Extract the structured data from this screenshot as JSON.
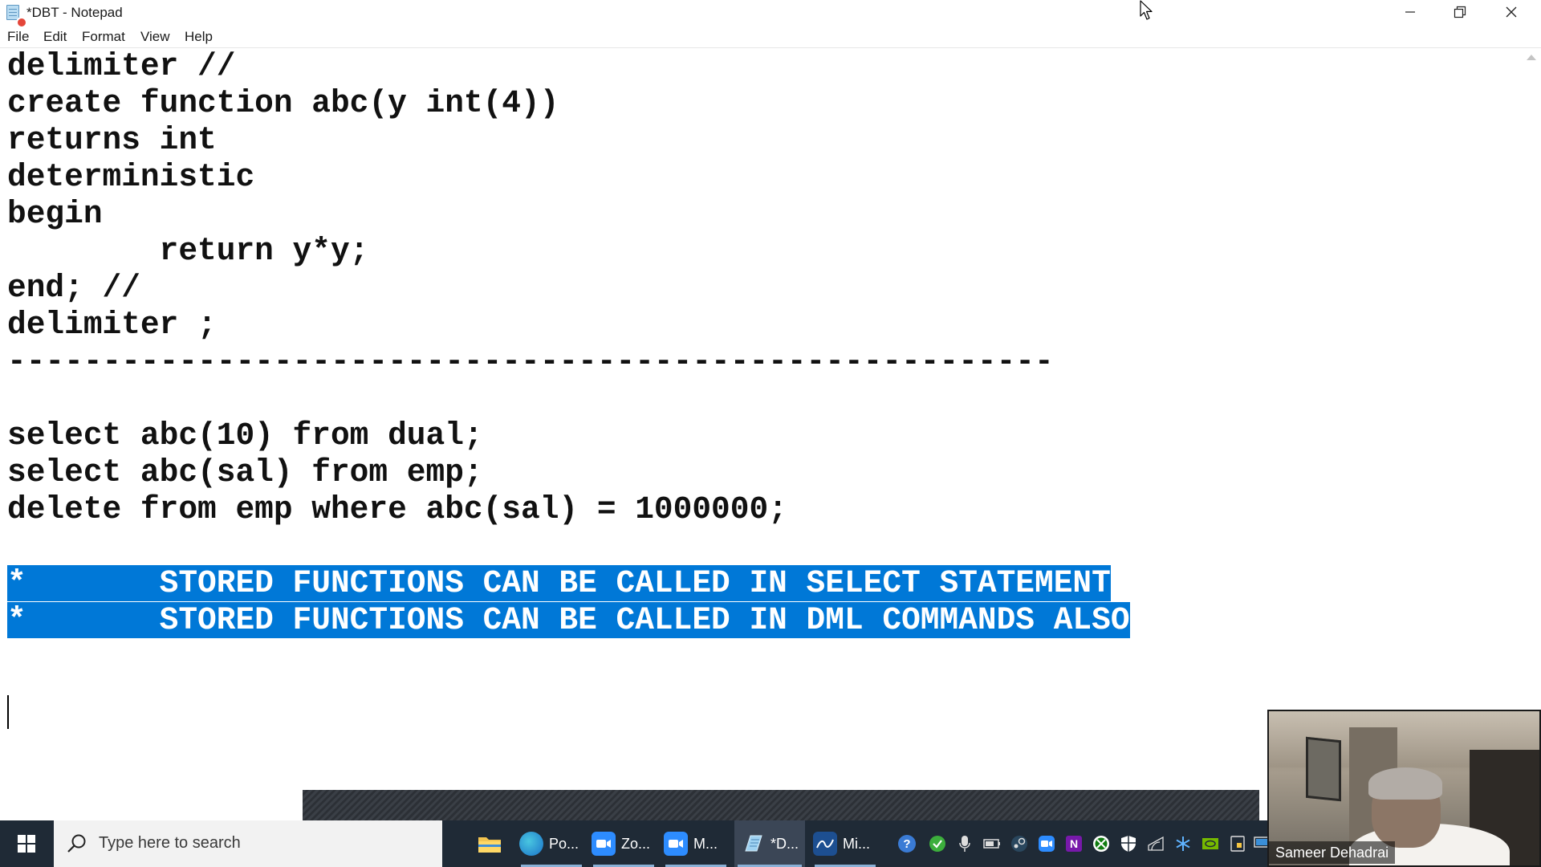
{
  "window": {
    "title": "*DBT - Notepad"
  },
  "menu": {
    "file": "File",
    "edit": "Edit",
    "format": "Format",
    "view": "View",
    "help": "Help"
  },
  "editor": {
    "lines": [
      "delimiter //",
      "create function abc(y int(4))",
      "returns int",
      "deterministic",
      "begin",
      "        return y*y;",
      "end; //",
      "delimiter ;",
      "-------------------------------------------------------",
      "",
      "select abc(10) from dual;",
      "select abc(sal) from emp;",
      "delete from emp where abc(sal) = 1000000;",
      ""
    ],
    "selected_lines": [
      "*       STORED FUNCTIONS CAN BE CALLED IN SELECT STATEMENT",
      "*       STORED FUNCTIONS CAN BE CALLED IN DML COMMANDS ALSO"
    ],
    "selection_color": "#0078d7"
  },
  "taskbar": {
    "search_placeholder": "Type here to search",
    "apps": [
      {
        "icon": "file-explorer-icon",
        "label": ""
      },
      {
        "icon": "edge-icon",
        "label": "Po..."
      },
      {
        "icon": "zoom-icon",
        "label": "Zo..."
      },
      {
        "icon": "zoom-meeting-icon",
        "label": "M..."
      },
      {
        "icon": "notepad-icon",
        "label": "*D..."
      },
      {
        "icon": "mysql-workbench-icon",
        "label": "Mi..."
      }
    ],
    "tray_icons": [
      "help-icon",
      "check-icon",
      "microphone-icon",
      "battery-icon",
      "steam-icon",
      "zoom-tray-icon",
      "onenote-icon",
      "xbox-icon",
      "shield-icon",
      "wifi-icon",
      "snowflake-icon",
      "nvidia-icon",
      "tablet-icon",
      "display-icon"
    ]
  },
  "webcam": {
    "participant_name": "Sameer Dehadrai"
  }
}
